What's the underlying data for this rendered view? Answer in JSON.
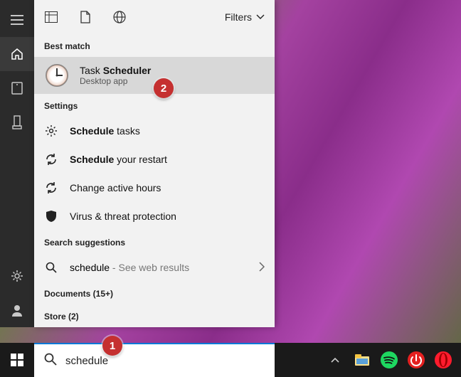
{
  "sidebar": {
    "items": [
      "menu",
      "home",
      "app1",
      "app2"
    ],
    "bottom": [
      "settings",
      "user"
    ]
  },
  "header": {
    "filters_label": "Filters"
  },
  "sections": {
    "best_match": "Best match",
    "settings": "Settings",
    "search_suggestions": "Search suggestions",
    "documents": "Documents (15+)",
    "store": "Store (2)"
  },
  "best_match": {
    "title_prefix": "Task ",
    "title_bold": "Scheduler",
    "subtitle": "Desktop app"
  },
  "settings_items": [
    {
      "icon": "gear",
      "bold": "Schedule",
      "rest": " tasks"
    },
    {
      "icon": "sync",
      "bold": "Schedule",
      "rest": " your restart"
    },
    {
      "icon": "sync",
      "bold": "",
      "rest": "Change active hours"
    },
    {
      "icon": "shield",
      "bold": "",
      "rest": "Virus & threat protection"
    }
  ],
  "web": {
    "query": "schedule",
    "suffix": " - See web results"
  },
  "search": {
    "value": "schedule"
  },
  "callouts": {
    "1": "1",
    "2": "2"
  },
  "tray": [
    "up",
    "explorer",
    "spotify",
    "power",
    "opera"
  ]
}
